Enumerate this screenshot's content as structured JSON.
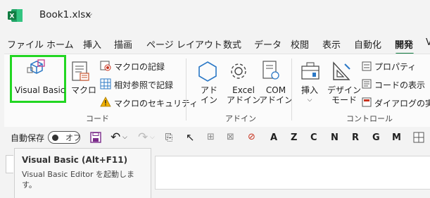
{
  "window": {
    "file_name": "Book1.xlsx",
    "chevron": "⌵"
  },
  "tabs": [
    {
      "label": "ファイル"
    },
    {
      "label": "ホーム"
    },
    {
      "label": "挿入"
    },
    {
      "label": "描画"
    },
    {
      "label": "ページ レイアウト"
    },
    {
      "label": "数式"
    },
    {
      "label": "データ"
    },
    {
      "label": "校閲"
    },
    {
      "label": "表示"
    },
    {
      "label": "自動化"
    },
    {
      "label": "開発"
    },
    {
      "label": "V"
    }
  ],
  "active_tab": "開発",
  "ribbon": {
    "code": {
      "visual_basic": "Visual Basic",
      "macro": "マクロ",
      "record_macro": "マクロの記録",
      "relative_ref": "相対参照で記録",
      "macro_security": "マクロのセキュリティ",
      "group_label": "コード"
    },
    "addins": {
      "addin_l1": "アド",
      "addin_l2": "イン",
      "excel_l1": "Excel",
      "excel_l2": "アドイン",
      "com_l1": "COM",
      "com_l2": "アドイン",
      "group_label": "アドイン"
    },
    "controls": {
      "insert": "挿入",
      "design_l1": "デザイン",
      "design_l2": "モード",
      "properties": "プロパティ",
      "view_code": "コードの表示",
      "run_dialog": "ダイアログの実行",
      "group_label": "コントロール"
    }
  },
  "qat": {
    "autosave": "自動保存",
    "toggle": "オフ",
    "letters": [
      "A",
      "Z",
      "C",
      "N",
      "R",
      "G",
      "M"
    ]
  },
  "tooltip": {
    "title": "Visual Basic (Alt+F11)",
    "desc": "Visual Basic Editor を起動します。"
  },
  "colors": {
    "accent": "#107c41",
    "highlight": "#22d622"
  }
}
